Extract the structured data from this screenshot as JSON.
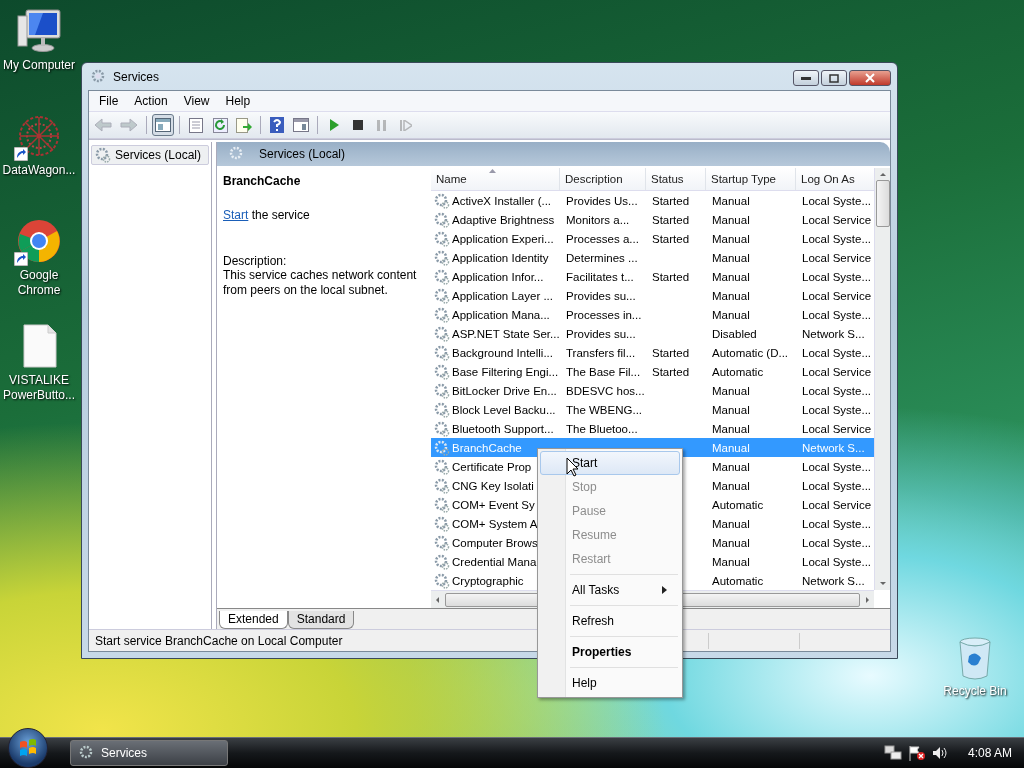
{
  "desktop_icons": [
    {
      "kind": "computer",
      "label": "My Computer",
      "shortcut": false
    },
    {
      "kind": "web",
      "label": "DataWagon...",
      "shortcut": true
    },
    {
      "kind": "browser",
      "label": "Google Chrome",
      "shortcut": true
    },
    {
      "kind": "file",
      "label": "VISTALIKE PowerButto...",
      "shortcut": false
    }
  ],
  "recycle_bin": {
    "label": "Recycle Bin"
  },
  "window": {
    "title": "Services",
    "menu": [
      "File",
      "Action",
      "View",
      "Help"
    ],
    "toolbar": [
      {
        "kind": "back",
        "disabled": true,
        "pressed": false
      },
      {
        "kind": "forward",
        "disabled": true,
        "pressed": false
      },
      {
        "kind": "separator"
      },
      {
        "kind": "tree",
        "disabled": false,
        "pressed": true
      },
      {
        "kind": "separator"
      },
      {
        "kind": "properties",
        "disabled": false,
        "pressed": false
      },
      {
        "kind": "refresh",
        "disabled": false,
        "pressed": false
      },
      {
        "kind": "export",
        "disabled": false,
        "pressed": false
      },
      {
        "kind": "separator"
      },
      {
        "kind": "help",
        "disabled": false,
        "pressed": false
      },
      {
        "kind": "view",
        "disabled": false,
        "pressed": false
      },
      {
        "kind": "separator"
      },
      {
        "kind": "play",
        "disabled": false,
        "pressed": false
      },
      {
        "kind": "stop",
        "disabled": false,
        "pressed": false
      },
      {
        "kind": "pause",
        "disabled": true,
        "pressed": false
      },
      {
        "kind": "resume",
        "disabled": true,
        "pressed": false
      }
    ],
    "tree": [
      {
        "label": "Services (Local)",
        "selected": true
      }
    ],
    "pane_title": "Services (Local)",
    "detail": {
      "title": "BranchCache",
      "link": "Start",
      "link_rest": "the service",
      "description_label": "Description:",
      "description": "This service caches network content from peers on the local subnet."
    },
    "columns": [
      {
        "label": "Name",
        "sorted": true
      },
      {
        "label": "Description",
        "sorted": false
      },
      {
        "label": "Status",
        "sorted": false
      },
      {
        "label": "Startup Type",
        "sorted": false
      },
      {
        "label": "Log On As",
        "sorted": false
      }
    ],
    "rows": [
      {
        "name": "ActiveX Installer (...",
        "description": "Provides Us...",
        "status": "Started",
        "startup": "Manual",
        "logon": "Local Syste...",
        "selected": false
      },
      {
        "name": "Adaptive Brightness",
        "description": "Monitors a...",
        "status": "Started",
        "startup": "Manual",
        "logon": "Local Service",
        "selected": false
      },
      {
        "name": "Application Experi...",
        "description": "Processes a...",
        "status": "Started",
        "startup": "Manual",
        "logon": "Local Syste...",
        "selected": false
      },
      {
        "name": "Application Identity",
        "description": "Determines ...",
        "startup": "Manual",
        "logon": "Local Service",
        "selected": false
      },
      {
        "name": "Application Infor...",
        "description": "Facilitates t...",
        "status": "Started",
        "startup": "Manual",
        "logon": "Local Syste...",
        "selected": false
      },
      {
        "name": "Application Layer ...",
        "description": "Provides su...",
        "startup": "Manual",
        "logon": "Local Service",
        "selected": false
      },
      {
        "name": "Application Mana...",
        "description": "Processes in...",
        "startup": "Manual",
        "logon": "Local Syste...",
        "selected": false
      },
      {
        "name": "ASP.NET State Ser...",
        "description": "Provides su...",
        "startup": "Disabled",
        "logon": "Network S...",
        "selected": false
      },
      {
        "name": "Background Intelli...",
        "description": "Transfers fil...",
        "status": "Started",
        "startup": "Automatic (D...",
        "logon": "Local Syste...",
        "selected": false
      },
      {
        "name": "Base Filtering Engi...",
        "description": "The Base Fil...",
        "status": "Started",
        "startup": "Automatic",
        "logon": "Local Service",
        "selected": false
      },
      {
        "name": "BitLocker Drive En...",
        "description": "BDESVC hos...",
        "startup": "Manual",
        "logon": "Local Syste...",
        "selected": false
      },
      {
        "name": "Block Level Backu...",
        "description": "The WBENG...",
        "startup": "Manual",
        "logon": "Local Syste...",
        "selected": false
      },
      {
        "name": "Bluetooth Support...",
        "description": "The Bluetoo...",
        "startup": "Manual",
        "logon": "Local Service",
        "selected": false
      },
      {
        "name": "BranchCache",
        "startup": "Manual",
        "logon": "Network S...",
        "selected": true
      },
      {
        "name": "Certificate Prop",
        "startup": "Manual",
        "logon": "Local Syste...",
        "selected": false
      },
      {
        "name": "CNG Key Isolati",
        "startup": "Manual",
        "logon": "Local Syste...",
        "selected": false
      },
      {
        "name": "COM+ Event Sy",
        "startup": "Automatic",
        "logon": "Local Service",
        "selected": false
      },
      {
        "name": "COM+ System A",
        "startup": "Manual",
        "logon": "Local Syste...",
        "selected": false
      },
      {
        "name": "Computer Brows",
        "startup": "Manual",
        "logon": "Local Syste...",
        "selected": false
      },
      {
        "name": "Credential Mana",
        "startup": "Manual",
        "logon": "Local Syste...",
        "selected": false
      },
      {
        "name": "Cryptographic",
        "startup": "Automatic",
        "logon": "Network S...",
        "selected": false
      }
    ],
    "tabs": [
      {
        "label": "Extended",
        "selected": true
      },
      {
        "label": "Standard",
        "selected": false
      }
    ],
    "status_bar": "Start service BranchCache on Local Computer"
  },
  "context_menu": {
    "items": [
      {
        "kind": "item",
        "label": "Start",
        "highlighted": true,
        "disabled": false,
        "default": false,
        "submenu": false
      },
      {
        "kind": "item",
        "label": "Stop",
        "highlighted": false,
        "disabled": true,
        "default": false,
        "submenu": false
      },
      {
        "kind": "item",
        "label": "Pause",
        "highlighted": false,
        "disabled": true,
        "default": false,
        "submenu": false
      },
      {
        "kind": "item",
        "label": "Resume",
        "highlighted": false,
        "disabled": true,
        "default": false,
        "submenu": false
      },
      {
        "kind": "item",
        "label": "Restart",
        "highlighted": false,
        "disabled": true,
        "default": false,
        "submenu": false
      },
      {
        "kind": "separator"
      },
      {
        "kind": "item",
        "label": "All Tasks",
        "highlighted": false,
        "disabled": false,
        "default": false,
        "submenu": true
      },
      {
        "kind": "separator"
      },
      {
        "kind": "item",
        "label": "Refresh",
        "highlighted": false,
        "disabled": false,
        "default": false,
        "submenu": false
      },
      {
        "kind": "separator"
      },
      {
        "kind": "item",
        "label": "Properties",
        "highlighted": false,
        "disabled": false,
        "default": true,
        "submenu": false
      },
      {
        "kind": "separator"
      },
      {
        "kind": "item",
        "label": "Help",
        "highlighted": false,
        "disabled": false,
        "default": false,
        "submenu": false
      }
    ]
  },
  "taskbar": {
    "button": "Services",
    "clock": "4:08 AM"
  }
}
